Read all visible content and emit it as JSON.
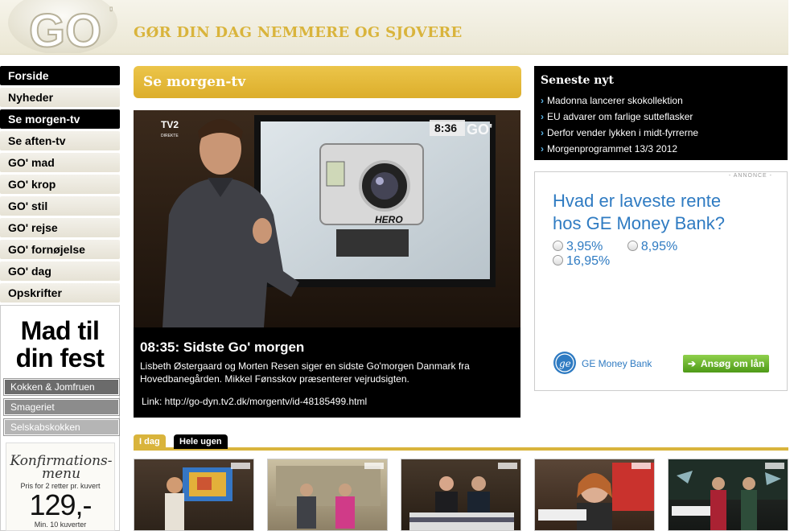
{
  "header": {
    "logo_text": "GO",
    "tagline": "GØR DIN DAG NEMMERE OG SJOVERE",
    "accent_color": "#d9b43c"
  },
  "nav": {
    "items": [
      {
        "label": "Forside",
        "active": true
      },
      {
        "label": "Nyheder",
        "active": false
      },
      {
        "label": "Se morgen-tv",
        "active": true
      },
      {
        "label": "Se aften-tv",
        "active": false
      },
      {
        "label": "GO' mad",
        "active": false
      },
      {
        "label": "GO' krop",
        "active": false
      },
      {
        "label": "GO' stil",
        "active": false
      },
      {
        "label": "GO' rejse",
        "active": false
      },
      {
        "label": "GO' fornøjelse",
        "active": false
      },
      {
        "label": "GO' dag",
        "active": false
      },
      {
        "label": "Opskrifter",
        "active": false
      }
    ]
  },
  "ad_left": {
    "headline_line1": "Mad til",
    "headline_line2": "din fest",
    "buttons": [
      {
        "label": "Kokken & Jomfruen",
        "color": "#6b6b6b"
      },
      {
        "label": "Smageriet",
        "color": "#8c8c8c"
      },
      {
        "label": "Selskabskokken",
        "color": "#b5b5b5"
      }
    ],
    "menu_card": {
      "title_line1": "Konfirmations-",
      "title_line2": "menu",
      "subtitle": "Pris for 2 retter pr. kuvert",
      "price": "129,-",
      "min_note": "Min. 10 kuverter"
    }
  },
  "main": {
    "section_title": "Se morgen-tv",
    "video": {
      "channel": "TV2",
      "channel_sub": "DIREKTE",
      "clock": "8:36",
      "watermark": "GO'",
      "camera_brand": "HERO"
    },
    "video_title": "08:35: Sidste Go' morgen",
    "video_description": "Lisbeth Østergaard og Morten Resen siger en sidste Go'morgen Danmark fra Hovedbanegården. Mikkel Fønsskov præsenterer vejrudsigten.",
    "video_link": "Link: http://go-dyn.tv2.dk/morgentv/id-48185499.html",
    "tabs": [
      {
        "label": "I dag",
        "active": true
      },
      {
        "label": "Hele ugen",
        "active": false
      }
    ]
  },
  "news": {
    "title": "Seneste nyt",
    "items": [
      "Madonna lancerer skokollektion",
      "EU advarer om farlige sutteflasker",
      "Derfor vender lykken i midt-fyrrerne",
      "Morgenprogrammet 13/3 2012"
    ]
  },
  "ad_right": {
    "label": "- ANNONCE -",
    "question_line1": "Hvad er laveste rente",
    "question_line2": "hos GE Money Bank?",
    "options": [
      "3,95%",
      "8,95%",
      "16,95%"
    ],
    "bank_name": "GE Money Bank",
    "cta": "Ansøg om lån"
  }
}
